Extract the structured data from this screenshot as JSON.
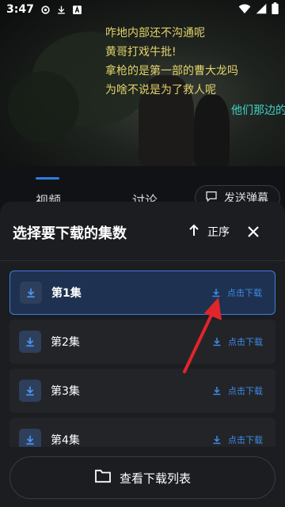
{
  "status": {
    "time": "3:47",
    "left_icons": [
      "settings-icon",
      "download-icon",
      "app-a-icon"
    ],
    "right_icons": [
      "wifi-icon",
      "signal-icon",
      "battery-icon"
    ]
  },
  "danmaku": [
    {
      "text": "咋地内部还不沟通呢",
      "color": "yellow"
    },
    {
      "text": "黄哥打戏牛批!",
      "color": "yellow"
    },
    {
      "text": "拿枪的是第一部的曹大龙吗",
      "color": "yellow"
    },
    {
      "text": "为啥不说是为了救人呢",
      "color": "yellow"
    },
    {
      "text": "他们那边的",
      "color": "cyan"
    }
  ],
  "tabs": {
    "video": "视频",
    "discuss": "讨论",
    "danmu_button": "发送弹幕"
  },
  "sheet": {
    "title": "选择要下载的集数",
    "sort_label": "正序",
    "episodes": [
      {
        "label": "第1集",
        "action": "点击下载",
        "selected": true
      },
      {
        "label": "第2集",
        "action": "点击下载",
        "selected": false
      },
      {
        "label": "第3集",
        "action": "点击下载",
        "selected": false
      },
      {
        "label": "第4集",
        "action": "点击下载",
        "selected": false
      }
    ],
    "view_list_button": "查看下载列表"
  },
  "colors": {
    "accent": "#3d8be8",
    "danmaku_yellow": "#e2d36b",
    "danmaku_cyan": "#3fd2c8",
    "annotation_arrow": "#e0262b"
  }
}
